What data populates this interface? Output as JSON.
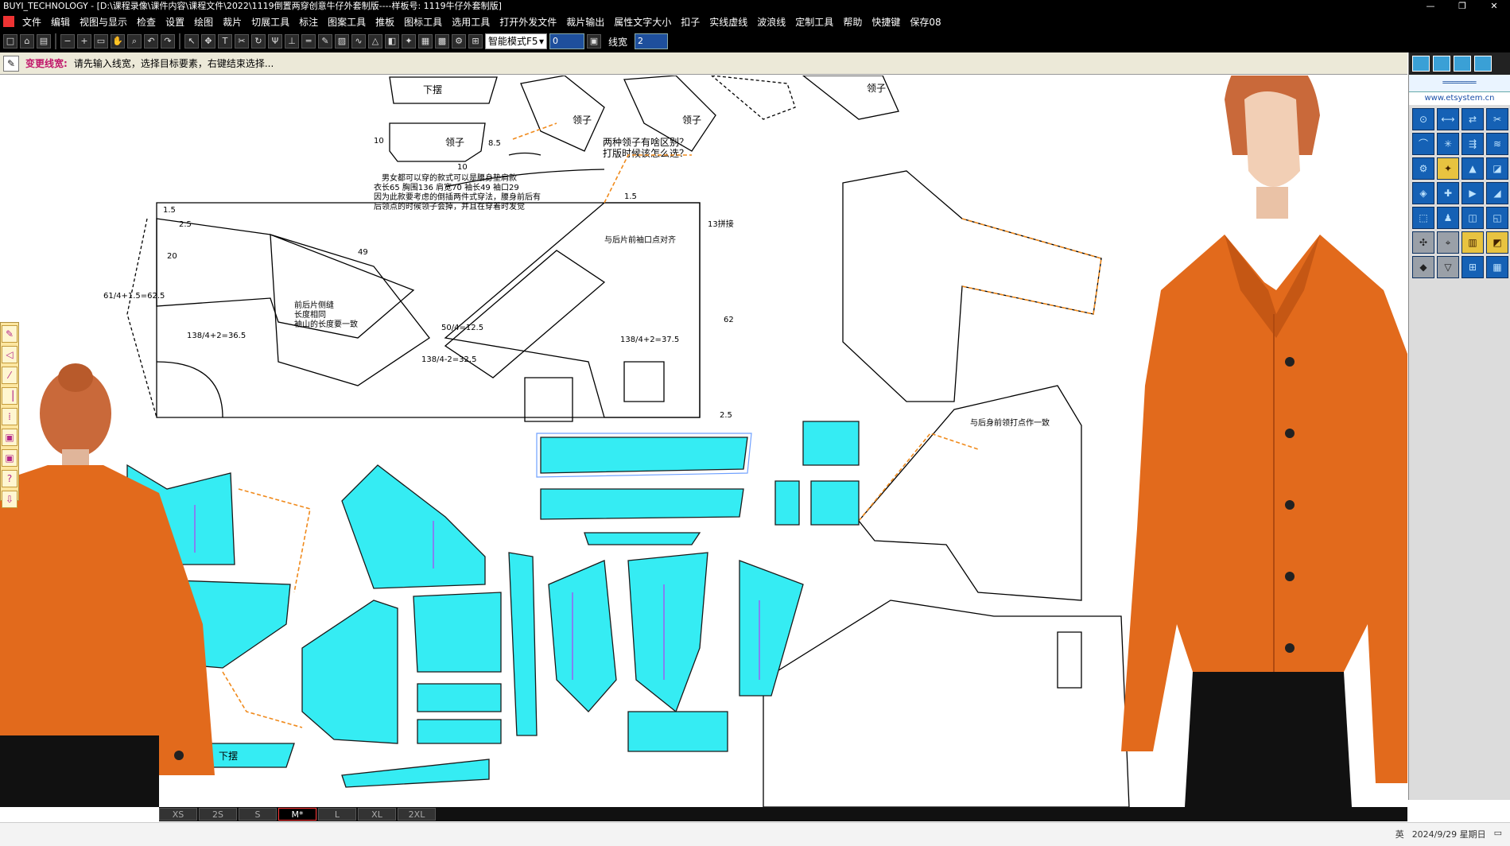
{
  "window": {
    "title": "BUYI_TECHNOLOGY - [D:\\课程录像\\课件内容\\课程文件\\2022\\1119倒置两穿创意牛仔外套制版----样板号: 1119牛仔外套制版]",
    "controls": [
      "—",
      "❐",
      "✕"
    ]
  },
  "menu": {
    "items": [
      "文件",
      "编辑",
      "视图与显示",
      "检查",
      "设置",
      "绘图",
      "裁片",
      "切展工具",
      "标注",
      "图案工具",
      "推板",
      "图标工具",
      "选用工具",
      "打开外发文件",
      "裁片输出",
      "属性文字大小",
      "扣子",
      "实线虚线",
      "波浪线",
      "定制工具",
      "帮助",
      "快捷键",
      "保存08"
    ]
  },
  "toolbar": {
    "mode_select": "智能模式F5",
    "value_input": "0",
    "line_width_label": "线宽",
    "line_width_value": "2",
    "buttons": [
      "new",
      "open",
      "save",
      "zoom-out",
      "zoom-in",
      "fit",
      "pan",
      "zoom-window",
      "undo",
      "redo",
      "select",
      "move",
      "text",
      "cut",
      "rotate",
      "mirror",
      "line",
      "parallel",
      "color",
      "hatch",
      "grid"
    ]
  },
  "status": {
    "title": "变更线宽:",
    "message": "请先输入线宽，选择目标要素，右键结束选择..."
  },
  "canvas": {
    "note_top": [
      "两种领子有啥区别？",
      "打版时候该怎么选？"
    ],
    "note_back": [
      "男女都可以穿的款式可以是腰身垫肩款",
      "衣长65  胸围136  肩宽70  袖长49  袖口29",
      "因为此款要考虑的倒插两件式穿法，腰身前后有",
      "后领点的时候领子会掉，并且在穿着时发觉"
    ],
    "label_lingzi": "领子",
    "label_xiabai": "下摆",
    "label_piece_note": "与后身前领打点作一致",
    "label_sleeve_note": "与后片前袖口点对齐",
    "label_back_note": [
      "前后片侧缝",
      "长度相同",
      "袖山的长度要一致"
    ],
    "dims": [
      "10",
      "8.5",
      "10",
      "1.5",
      "2.5",
      "20",
      "49",
      "61/4+1.5=62.5",
      "138/4+2=36.5",
      "138/4+2=37.5",
      "138/4-2=32.5",
      "62",
      "13拼接",
      "2.5",
      "1.5",
      "50/4=12.5"
    ]
  },
  "left_palette": {
    "buttons": [
      "✎",
      "◁",
      "⁄",
      "▕",
      "⁞",
      "▣",
      "▣",
      "?",
      "⇩"
    ]
  },
  "right_panel": {
    "website": "www.etsystem.cn",
    "tools": [
      "⊙",
      "⟷",
      "⇄",
      "✂",
      "⌒",
      "✳",
      "⇶",
      "≋",
      "⚙",
      "✦",
      "▲",
      "◪",
      "◈",
      "✚",
      "▶",
      "◢",
      "⬚",
      "♟",
      "◫",
      "◱",
      "✣",
      "⌖",
      "▥",
      "◩",
      "◆",
      "▽",
      "⊞",
      "▦"
    ]
  },
  "sizes": {
    "tabs": [
      "XS",
      "2S",
      "S",
      "M*",
      "L",
      "XL",
      "2XL"
    ],
    "active": "M*"
  },
  "taskbar": {
    "ime": "英",
    "date": "2024/9/29 星期日"
  },
  "colors": {
    "piece_fill": "#35ecf3",
    "seam_orange": "#f08a1c",
    "grain_purple": "#b43df2",
    "jacket_orange": "#e26a1c"
  }
}
